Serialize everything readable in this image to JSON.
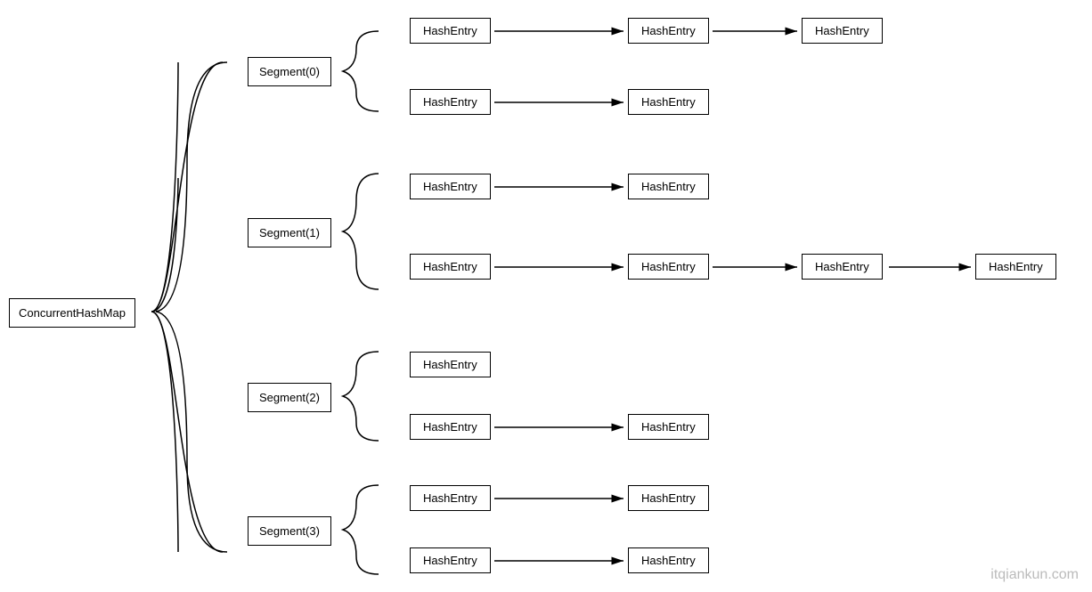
{
  "root": {
    "label": "ConcurrentHashMap"
  },
  "segments": [
    {
      "label": "Segment(0)"
    },
    {
      "label": "Segment(1)"
    },
    {
      "label": "Segment(2)"
    },
    {
      "label": "Segment(3)"
    }
  ],
  "chains": {
    "seg0_row0": [
      "HashEntry",
      "HashEntry",
      "HashEntry"
    ],
    "seg0_row1": [
      "HashEntry",
      "HashEntry"
    ],
    "seg1_row0": [
      "HashEntry",
      "HashEntry"
    ],
    "seg1_row1": [
      "HashEntry",
      "HashEntry",
      "HashEntry",
      "HashEntry"
    ],
    "seg2_row0": [
      "HashEntry"
    ],
    "seg2_row1": [
      "HashEntry",
      "HashEntry"
    ],
    "seg3_row0": [
      "HashEntry",
      "HashEntry"
    ],
    "seg3_row1": [
      "HashEntry",
      "HashEntry"
    ]
  },
  "watermark": "itqiankun.com"
}
